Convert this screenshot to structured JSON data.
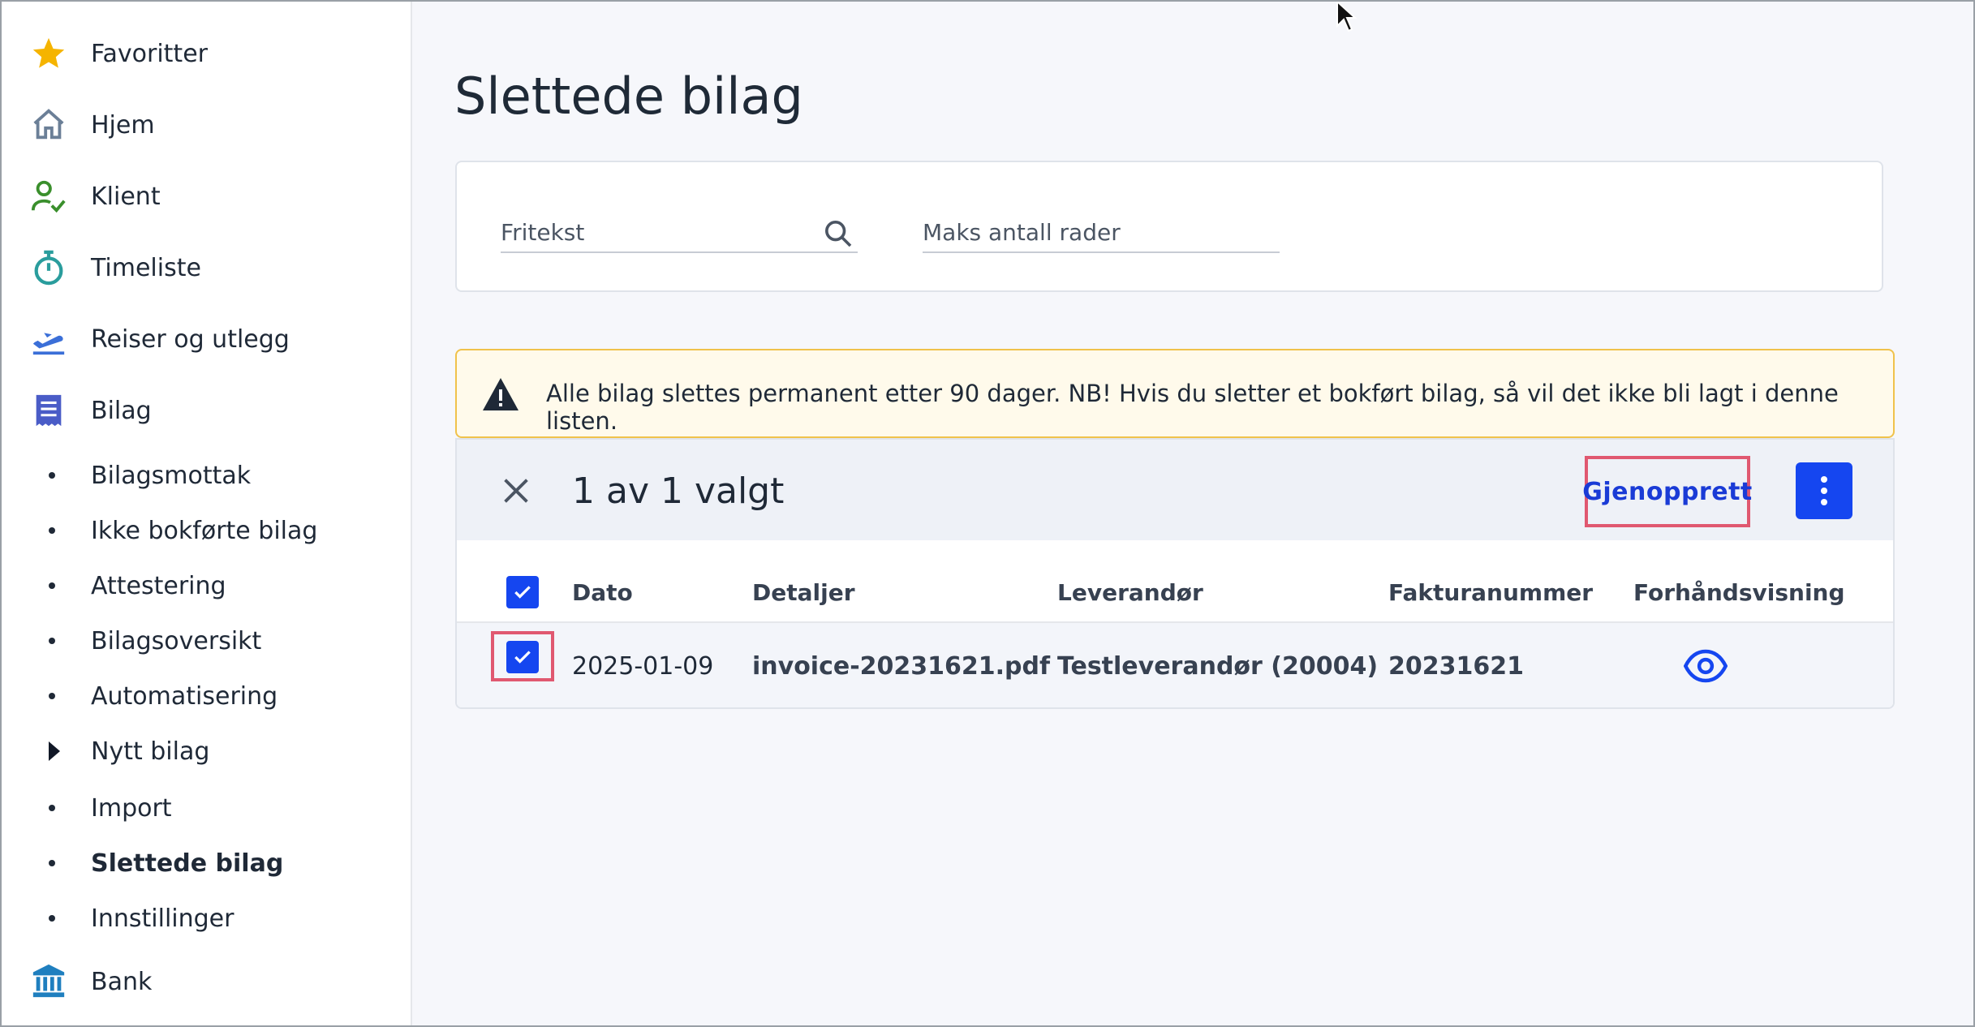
{
  "sidebar": {
    "nav": [
      {
        "label": "Favoritter",
        "icon": "star-icon"
      },
      {
        "label": "Hjem",
        "icon": "home-icon"
      },
      {
        "label": "Klient",
        "icon": "client-check-icon"
      },
      {
        "label": "Timeliste",
        "icon": "stopwatch-icon"
      },
      {
        "label": "Reiser og utlegg",
        "icon": "plane-departure-icon"
      },
      {
        "label": "Bilag",
        "icon": "receipt-icon"
      }
    ],
    "bilag_sub": [
      {
        "label": "Bilagsmottak"
      },
      {
        "label": "Ikke bokførte bilag"
      },
      {
        "label": "Attestering"
      },
      {
        "label": "Bilagsoversikt"
      },
      {
        "label": "Automatisering"
      },
      {
        "label": "Nytt bilag"
      },
      {
        "label": "Import"
      },
      {
        "label": "Slettede bilag"
      },
      {
        "label": "Innstillinger"
      }
    ],
    "bank": {
      "label": "Bank",
      "icon": "bank-icon"
    }
  },
  "page": {
    "title": "Slettede bilag"
  },
  "filters": {
    "fritekst_label": "Fritekst",
    "maks_label": "Maks antall rader"
  },
  "alert": {
    "text": "Alle bilag slettes permanent etter 90 dager. NB! Hvis du sletter et bokført bilag, så vil det ikke bli lagt i denne listen."
  },
  "selection": {
    "count_text": "1 av 1 valgt",
    "restore_label": "Gjenopprett"
  },
  "table": {
    "headers": {
      "dato": "Dato",
      "detaljer": "Detaljer",
      "leverandor": "Leverandør",
      "fakturanummer": "Fakturanummer",
      "forhandsvisning": "Forhåndsvisning"
    },
    "rows": [
      {
        "dato": "2025-01-09",
        "detaljer": "invoice-20231621.pdf",
        "leverandor": "Testleverandør (20004)",
        "fakturanummer": "20231621"
      }
    ]
  },
  "colors": {
    "accent": "#1546f0",
    "highlight": "#e05870",
    "warning": "#f0c24b"
  }
}
